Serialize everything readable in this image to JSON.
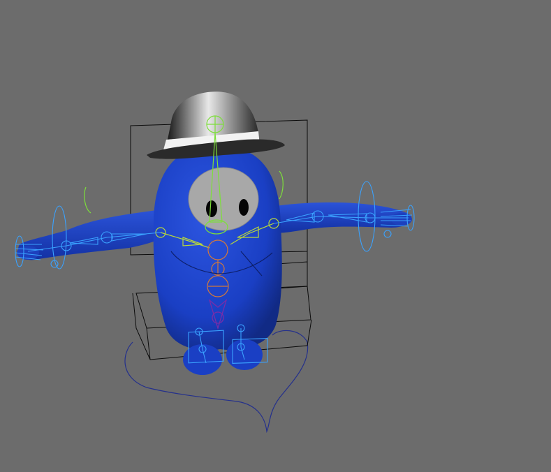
{
  "viewport": {
    "background": "#6c6c6c"
  },
  "character": {
    "body_color": "#1a3fc4",
    "face_color": "#a8a8a8",
    "eye_color": "#050505",
    "hat_color": "#3a3a3a",
    "hat_band_color": "#f2f2f2"
  },
  "rig": {
    "joint_color_green": "#7ddf3a",
    "joint_color_blue": "#3aa2ff",
    "joint_color_orange": "#d4793a",
    "joint_color_purple": "#7a2ca8",
    "curve_color_dark_blue": "#24308c",
    "cage_color": "#0b0b0b"
  }
}
